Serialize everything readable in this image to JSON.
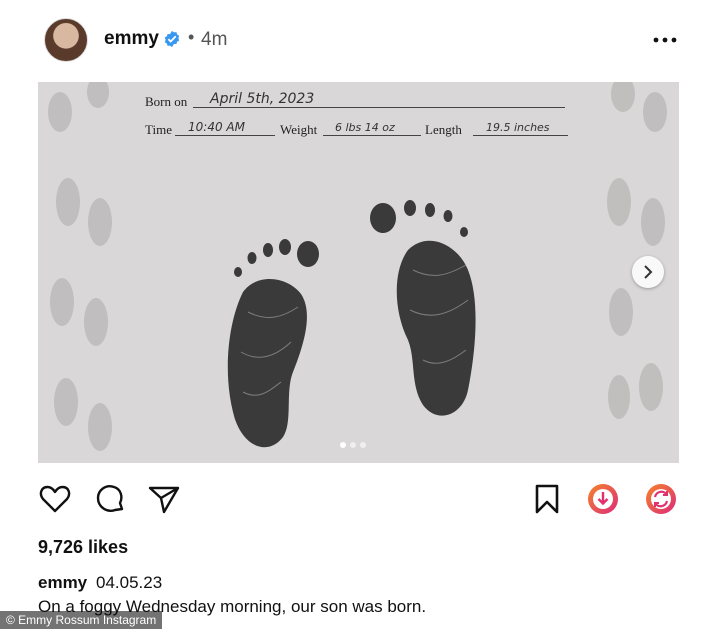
{
  "post": {
    "username": "emmy",
    "time_sep": "•",
    "time": "4m",
    "likes": "9,726 likes",
    "caption_user": "emmy",
    "caption_date": "04.05.23",
    "caption_text": "On a foggy Wednesday morning, our son was born.",
    "carousel_page": 1,
    "carousel_total": 3
  },
  "certificate": {
    "born_on_label": "Born on",
    "born_on_value": "April 5th, 2023",
    "time_label": "Time",
    "time_value": "10:40 AM",
    "weight_label": "Weight",
    "weight_value": "6 lbs 14 oz",
    "length_label": "Length",
    "length_value": "19.5 inches"
  },
  "credit": "© Emmy Rossum Instagram",
  "colors": {
    "verified": "#3897f0",
    "gradient_start": "#f58529",
    "gradient_end": "#dd2a7b"
  },
  "icons": [
    "heart-icon",
    "comment-icon",
    "share-icon",
    "bookmark-icon",
    "download-icon",
    "repost-icon",
    "more-icon",
    "verified-icon",
    "chevron-right-icon"
  ]
}
